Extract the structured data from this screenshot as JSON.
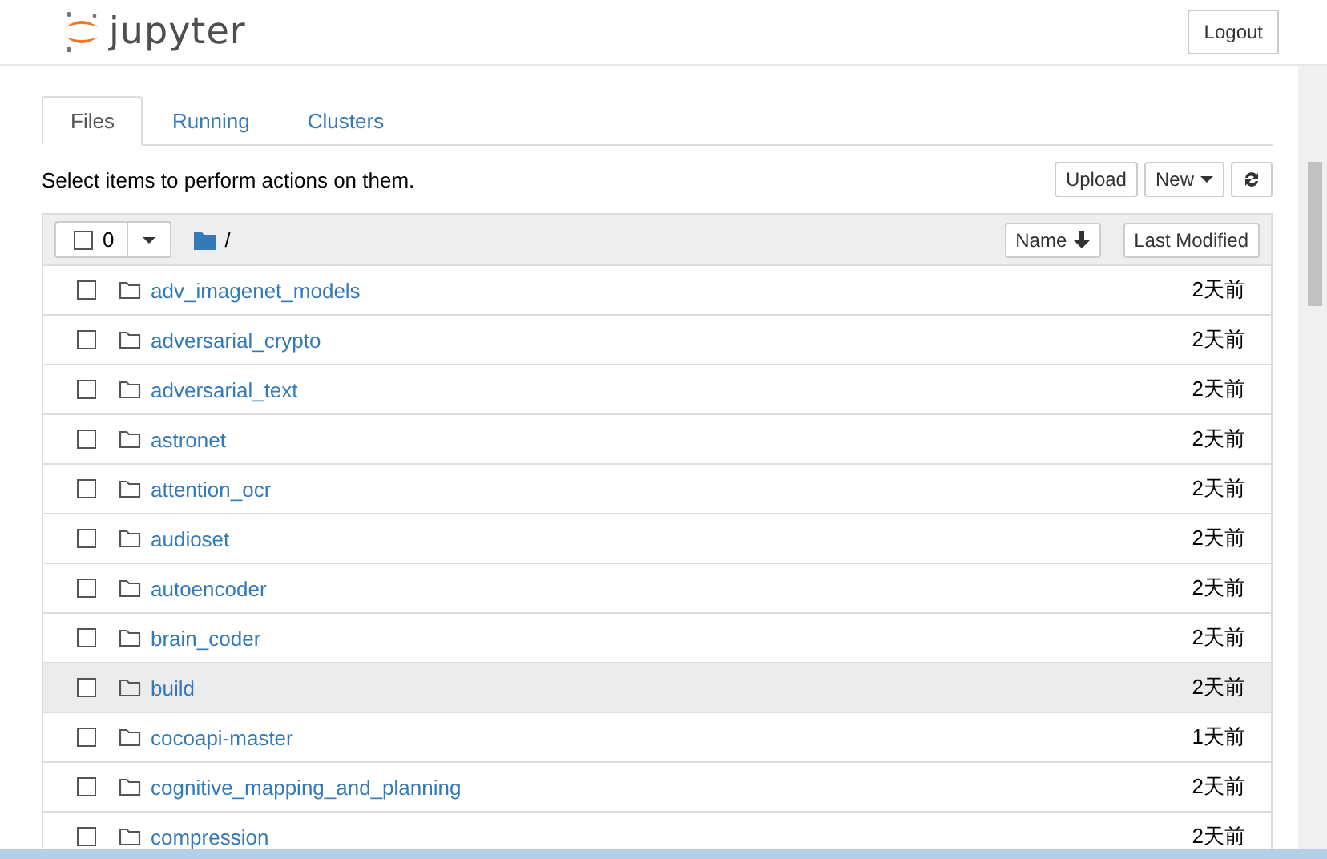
{
  "header": {
    "logo": "jupyter",
    "logout": "Logout"
  },
  "tabs": [
    {
      "label": "Files",
      "selected": true
    },
    {
      "label": "Running",
      "selected": false
    },
    {
      "label": "Clusters",
      "selected": false
    }
  ],
  "toolbar": {
    "hint": "Select items to perform actions on them.",
    "upload": "Upload",
    "new": "New"
  },
  "list_header": {
    "select_all_checked": false,
    "selected_count": "0",
    "path": "/",
    "sort_name": "Name",
    "sort_modified": "Last Modified"
  },
  "rows": [
    {
      "name": "adv_imagenet_models",
      "modified": "2天前",
      "highlighted": false
    },
    {
      "name": "adversarial_crypto",
      "modified": "2天前",
      "highlighted": false
    },
    {
      "name": "adversarial_text",
      "modified": "2天前",
      "highlighted": false
    },
    {
      "name": "astronet",
      "modified": "2天前",
      "highlighted": false
    },
    {
      "name": "attention_ocr",
      "modified": "2天前",
      "highlighted": false
    },
    {
      "name": "audioset",
      "modified": "2天前",
      "highlighted": false
    },
    {
      "name": "autoencoder",
      "modified": "2天前",
      "highlighted": false
    },
    {
      "name": "brain_coder",
      "modified": "2天前",
      "highlighted": false
    },
    {
      "name": "build",
      "modified": "2天前",
      "highlighted": true
    },
    {
      "name": "cocoapi-master",
      "modified": "1天前",
      "highlighted": false
    },
    {
      "name": "cognitive_mapping_and_planning",
      "modified": "2天前",
      "highlighted": false
    },
    {
      "name": "compression",
      "modified": "2天前",
      "highlighted": false
    }
  ]
}
